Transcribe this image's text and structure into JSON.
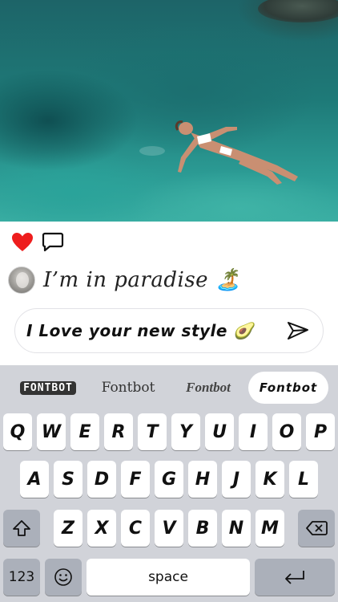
{
  "post": {
    "caption": "I’m in paradise 🏝️",
    "liked": true,
    "like_color": "#ee1d1d"
  },
  "comment": {
    "value": "I Love your new style 🥑"
  },
  "font_bar": {
    "options": [
      "FONTBOT",
      "Fontbot",
      "Fontbot",
      "Fontbot"
    ],
    "selected_index": 3
  },
  "keyboard": {
    "row1": [
      "Q",
      "W",
      "E",
      "R",
      "T",
      "Y",
      "U",
      "I",
      "O",
      "P"
    ],
    "row2": [
      "A",
      "S",
      "D",
      "F",
      "G",
      "H",
      "J",
      "K",
      "L"
    ],
    "row3": [
      "Z",
      "X",
      "C",
      "V",
      "B",
      "N",
      "M"
    ],
    "numbers_label": "123",
    "space_label": "space"
  },
  "icons": {
    "like": "heart-icon",
    "comment": "speech-bubble-icon",
    "send": "paper-plane-icon",
    "shift": "shift-arrow-icon",
    "delete": "backspace-icon",
    "emoji": "emoji-icon",
    "return": "return-arrow-icon"
  }
}
